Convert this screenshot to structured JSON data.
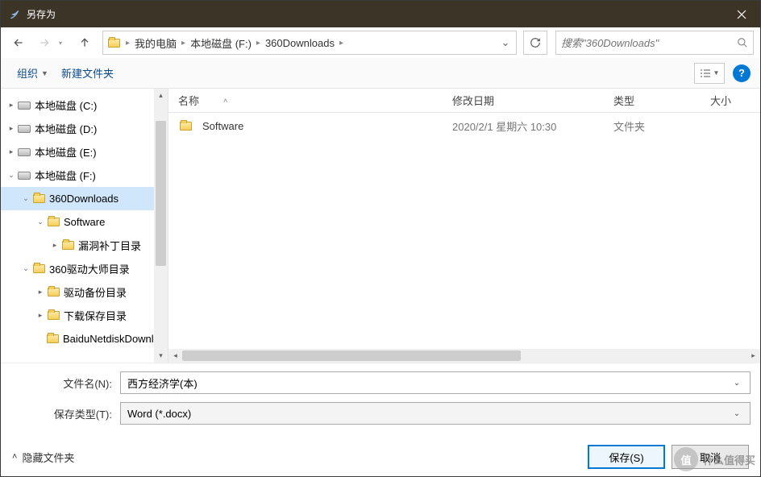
{
  "title": "另存为",
  "breadcrumbs": [
    "我的电脑",
    "本地磁盘 (F:)",
    "360Downloads"
  ],
  "search": {
    "placeholder": "搜索\"360Downloads\""
  },
  "toolbar": {
    "organize": "组织",
    "newfolder": "新建文件夹"
  },
  "columns": {
    "name": "名称",
    "date": "修改日期",
    "type": "类型",
    "size": "大小"
  },
  "tree": {
    "c": "本地磁盘 (C:)",
    "d": "本地磁盘 (D:)",
    "e": "本地磁盘 (E:)",
    "f": "本地磁盘 (F:)",
    "f_360dl": "360Downloads",
    "f_software": "Software",
    "f_patch": "漏洞补丁目录",
    "f_driver": "360驱动大师目录",
    "f_backup": "驱动备份目录",
    "f_dlsave": "下载保存目录",
    "f_baidu": "BaiduNetdiskDownload"
  },
  "files": [
    {
      "name": "Software",
      "date": "2020/2/1 星期六 10:30",
      "type": "文件夹",
      "size": ""
    }
  ],
  "form": {
    "filename_label": "文件名(N):",
    "filename_value": "西方经济学(本)",
    "filetype_label": "保存类型(T):",
    "filetype_value": "Word (*.docx)"
  },
  "footer": {
    "hide": "隐藏文件夹",
    "save": "保存(S)",
    "cancel": "取消"
  },
  "watermark": "什么值得买"
}
